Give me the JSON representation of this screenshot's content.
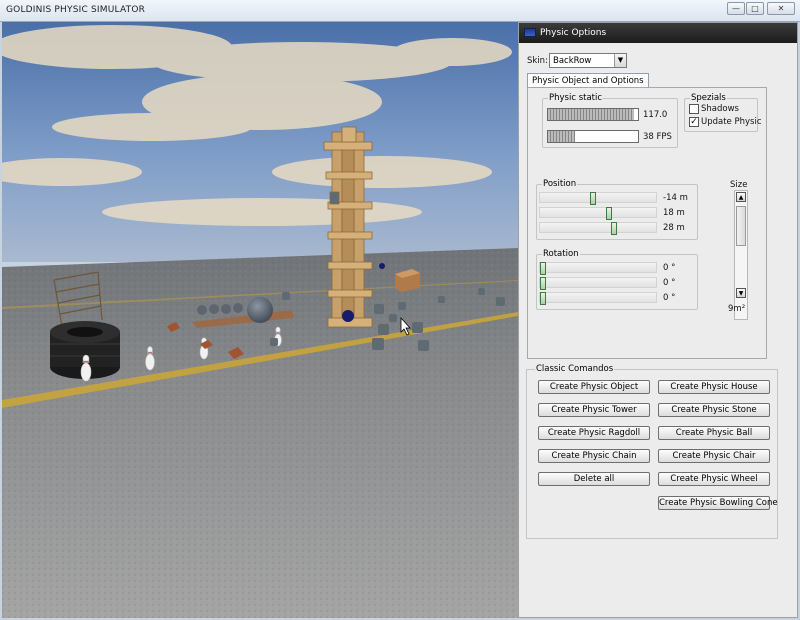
{
  "window": {
    "title": "GOLDINIS PHYSIC SIMULATOR"
  },
  "panel": {
    "title": "Physic Options",
    "skin_label": "Skin:",
    "skin_value": "BackRow",
    "tab_label": "Physic Object and Options",
    "physic_static": {
      "title": "Physic static",
      "bar1_value": "117.0",
      "bar1_level": 0.96,
      "bar2_value": "38 FPS",
      "bar2_level": 0.3
    },
    "specials": {
      "title": "Spezials",
      "shadows_label": "Shadows",
      "shadows_checked": false,
      "update_label": "Update Physic",
      "update_checked": true
    },
    "position": {
      "title": "Position",
      "sliders": [
        {
          "value": "-14 m",
          "level": 0.43
        },
        {
          "value": "18 m",
          "level": 0.57
        },
        {
          "value": "28 m",
          "level": 0.61
        }
      ]
    },
    "rotation": {
      "title": "Rotation",
      "sliders": [
        {
          "value": "0 °",
          "level": 0.0
        },
        {
          "value": "0 °",
          "level": 0.0
        },
        {
          "value": "0 °",
          "level": 0.0
        }
      ]
    },
    "size": {
      "title": "Size",
      "value": "9m²"
    },
    "commands": {
      "title": "Classic Comandos",
      "buttons": [
        "Create Physic Object",
        "Create Physic House",
        "Create Physic Tower",
        "Create Physic Stone",
        "Create Physic Ragdoll",
        "Create Physic Ball",
        "Create Physic Chain",
        "Create Physic Chair",
        "Delete all",
        "Create Physic Wheel",
        "Create Physic Bowling Cone"
      ]
    }
  },
  "colors": {
    "sky_top": "#4a6fa8",
    "asphalt": "#8e8e8e",
    "road_line": "#c9a43a",
    "wood": "#c8a06a",
    "panel_bg": "#ececec",
    "slider_thumb": "#a8d0a8"
  },
  "icons": [
    "window-app-icon",
    "minimize-icon",
    "maximize-icon",
    "close-icon",
    "dropdown-arrow-icon",
    "scroll-up-icon",
    "scroll-down-icon",
    "checkmark-icon",
    "mouse-cursor-icon"
  ]
}
